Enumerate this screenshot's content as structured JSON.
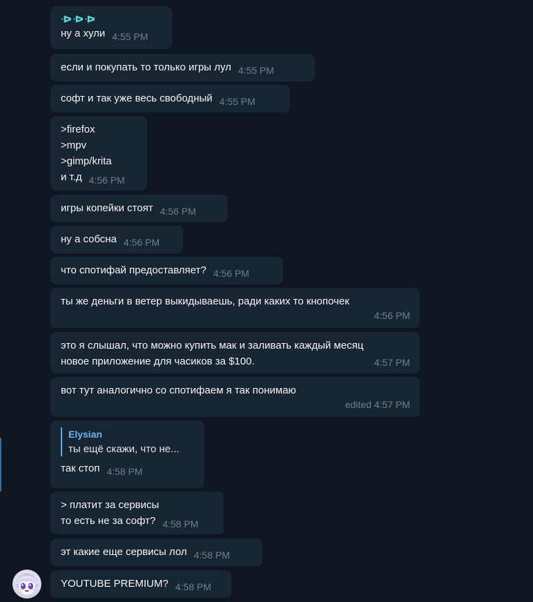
{
  "messages": [
    {
      "sender": "ᐒᐒᐒ",
      "text": "ну а хули",
      "time": "4:55 PM"
    },
    {
      "text": "если и покупать то только игры лул",
      "time": "4:55 PM"
    },
    {
      "text": "софт и так уже весь свободный",
      "time": "4:55 PM"
    },
    {
      "lines": [
        ">firefox",
        ">mpv",
        ">gimp/krita"
      ],
      "text": "и т.д",
      "time": "4:56 PM"
    },
    {
      "text": "игры копейки стоят",
      "time": "4:56 PM"
    },
    {
      "text": "ну а собсна",
      "time": "4:56 PM"
    },
    {
      "text": "что спотифай предоставляет?",
      "time": "4:56 PM"
    },
    {
      "text": "ты же деньги в ветер выкидываешь, ради каких то кнопочек",
      "time": "4:56 PM"
    },
    {
      "lines": [
        "это я слышал, что можно купить мак и заливать каждый месяц"
      ],
      "text": "новое приложение для часиков за $100.",
      "time": "4:57 PM"
    },
    {
      "text": "вот тут аналогично со спотифаем я так понимаю",
      "time": "edited 4:57 PM"
    },
    {
      "reply": {
        "name": "Elysian",
        "text": "ты ещё скажи, что не..."
      },
      "text": "так стоп",
      "time": "4:58 PM"
    },
    {
      "lines": [
        "> платит за сервисы"
      ],
      "text": "то есть не за софт?",
      "time": "4:58 PM"
    },
    {
      "text": "эт какие еще сервисы лол",
      "time": "4:58 PM"
    },
    {
      "text": "YOUTUBE PREMIUM?",
      "time": "4:58 PM"
    }
  ],
  "avatar_icon": "anime-girl-avatar",
  "colors": {
    "background": "#0e1621",
    "bubble": "#182533",
    "text": "#f5f5f5",
    "time": "#6d7f8f",
    "sender": "#5fd4d4",
    "reply_name": "#6ab3f3",
    "reply_bar": "#5eacec"
  }
}
